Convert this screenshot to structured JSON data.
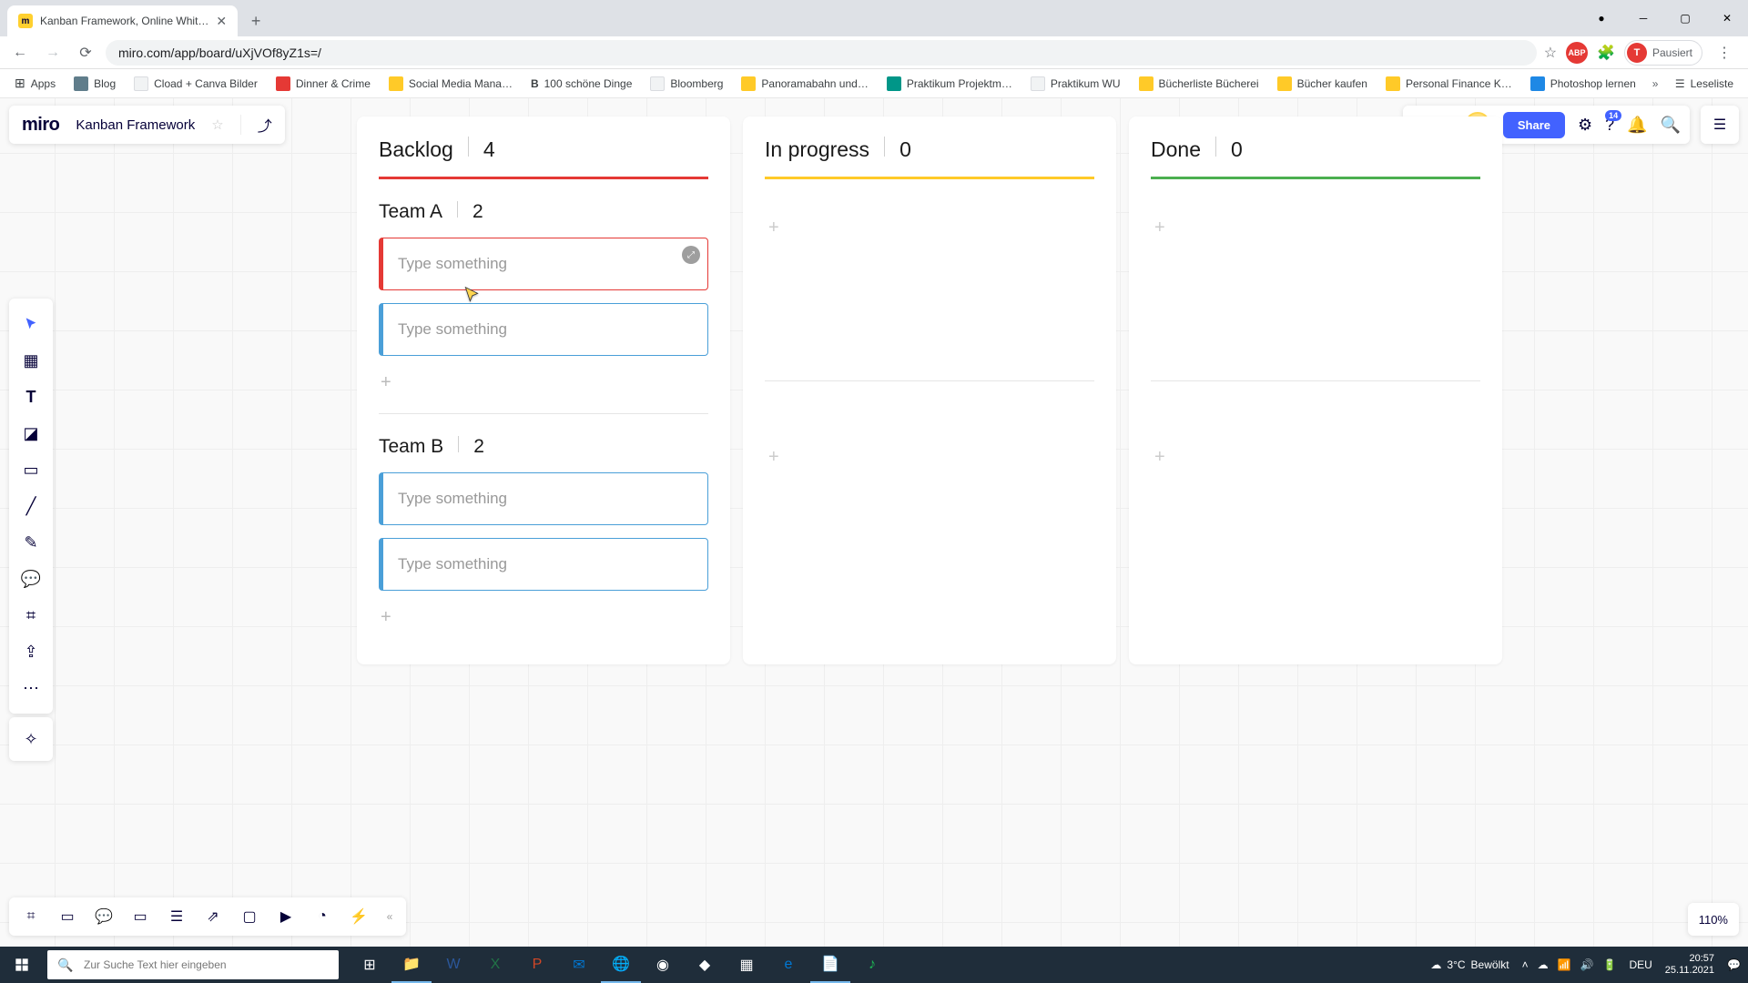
{
  "browser": {
    "tab_title": "Kanban Framework, Online Whit…",
    "url": "miro.com/app/board/uXjVOf8yZ1s=/",
    "pause_label": "Pausiert",
    "readlist": "Leseliste"
  },
  "bookmarks": [
    {
      "label": "Apps",
      "cls": ""
    },
    {
      "label": "Blog",
      "cls": "slate"
    },
    {
      "label": "Cload + Canva Bilder",
      "cls": ""
    },
    {
      "label": "Dinner & Crime",
      "cls": "red"
    },
    {
      "label": "Social Media Mana…",
      "cls": "yellow"
    },
    {
      "label": "100 schöne Dinge",
      "cls": ""
    },
    {
      "label": "Bloomberg",
      "cls": ""
    },
    {
      "label": "Panoramabahn und…",
      "cls": "yellow"
    },
    {
      "label": "Praktikum Projektm…",
      "cls": "teal"
    },
    {
      "label": "Praktikum WU",
      "cls": ""
    },
    {
      "label": "Bücherliste Bücherei",
      "cls": "yellow"
    },
    {
      "label": "Bücher kaufen",
      "cls": "yellow"
    },
    {
      "label": "Personal Finance K…",
      "cls": "yellow"
    },
    {
      "label": "Photoshop lernen",
      "cls": "blue"
    }
  ],
  "miro": {
    "logo": "miro",
    "board_name": "Kanban Framework",
    "share": "Share",
    "help_badge": "14",
    "zoom": "110%"
  },
  "kanban": {
    "columns": [
      {
        "title": "Backlog",
        "count": "4",
        "line": "line-red"
      },
      {
        "title": "In progress",
        "count": "0",
        "line": "line-yellow"
      },
      {
        "title": "Done",
        "count": "0",
        "line": "line-green"
      }
    ],
    "swimlanes": [
      {
        "title": "Team A",
        "count": "2"
      },
      {
        "title": "Team B",
        "count": "2"
      }
    ],
    "placeholder": "Type something"
  },
  "taskbar": {
    "search_placeholder": "Zur Suche Text hier eingeben",
    "weather_temp": "3°C",
    "weather_text": "Bewölkt",
    "lang": "DEU",
    "time": "20:57",
    "date": "25.11.2021"
  }
}
